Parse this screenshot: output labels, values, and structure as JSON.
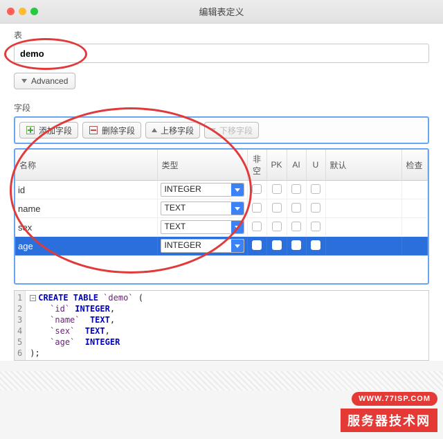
{
  "window": {
    "title": "编辑表定义"
  },
  "section": {
    "table_label": "表",
    "fields_label": "字段"
  },
  "table_input": {
    "value": "demo"
  },
  "advanced_label": "Advanced",
  "toolbar": {
    "add": "添加字段",
    "remove": "删除字段",
    "move_up": "上移字段",
    "move_down": "下移字段"
  },
  "columns": {
    "name": "名称",
    "type": "类型",
    "notnull": "非空",
    "pk": "PK",
    "ai": "AI",
    "u": "U",
    "default": "默认",
    "check": "检查"
  },
  "rows": [
    {
      "name": "id",
      "type": "INTEGER",
      "selected": false
    },
    {
      "name": "name",
      "type": "TEXT",
      "selected": false
    },
    {
      "name": "sex",
      "type": "TEXT",
      "selected": false
    },
    {
      "name": "age",
      "type": "INTEGER",
      "selected": true
    }
  ],
  "sql": {
    "lines": [
      "CREATE TABLE `demo` (",
      "    `id` INTEGER,",
      "    `name`  TEXT,",
      "    `sex`  TEXT,",
      "    `age`  INTEGER",
      ");"
    ]
  },
  "badge": {
    "url": "WWW.77ISP.COM",
    "text": "服务器技术网"
  }
}
